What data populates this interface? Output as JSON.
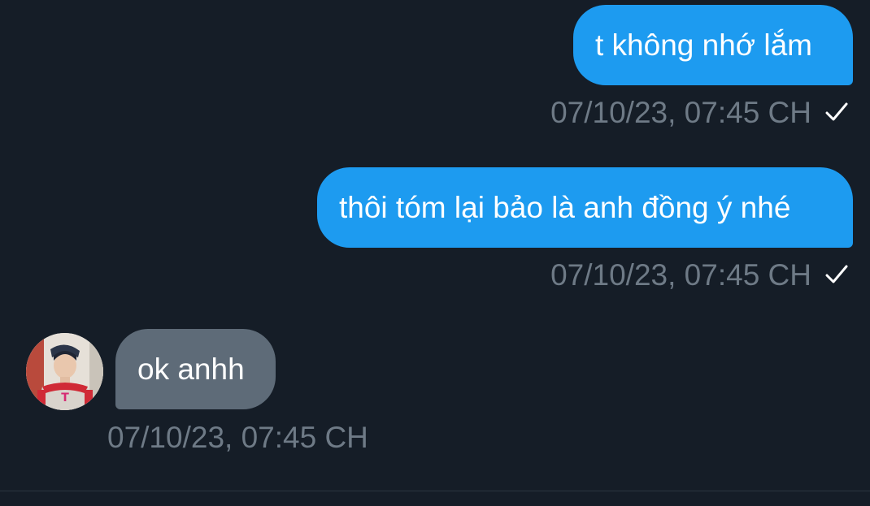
{
  "messages": [
    {
      "direction": "outgoing",
      "text": "t không nhớ lắm",
      "timestamp": "07/10/23, 07:45 CH",
      "status_icon": "check-icon"
    },
    {
      "direction": "outgoing",
      "text": "thôi tóm lại bảo là anh đồng ý nhé",
      "timestamp": "07/10/23, 07:45 CH",
      "status_icon": "check-icon"
    },
    {
      "direction": "incoming",
      "text": "ok anhh",
      "timestamp": "07/10/23, 07:45 CH",
      "avatar_icon": "profile-avatar"
    }
  ],
  "colors": {
    "background": "#151d27",
    "outgoing_bubble": "#1d9bf0",
    "incoming_bubble": "#5e6b78",
    "meta_text": "#6e7a86"
  }
}
